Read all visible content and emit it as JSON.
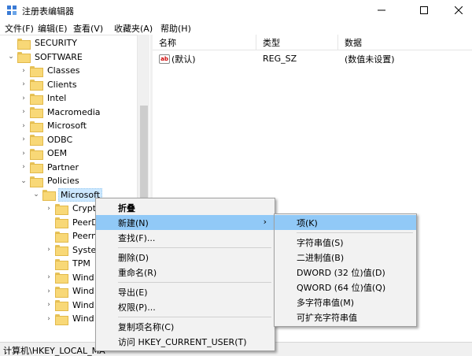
{
  "window": {
    "title": "注册表编辑器",
    "min": "—",
    "max": "☐",
    "close": "✕"
  },
  "menu": [
    "文件(F)",
    "编辑(E)",
    "查看(V)",
    "收藏夹(A)",
    "帮助(H)"
  ],
  "tree": [
    {
      "label": "SECURITY",
      "exp": "",
      "indent": 0
    },
    {
      "label": "SOFTWARE",
      "exp": "⌄",
      "indent": 0
    },
    {
      "label": "Classes",
      "exp": "›",
      "indent": 1
    },
    {
      "label": "Clients",
      "exp": "›",
      "indent": 1
    },
    {
      "label": "Intel",
      "exp": "›",
      "indent": 1
    },
    {
      "label": "Macromedia",
      "exp": "›",
      "indent": 1
    },
    {
      "label": "Microsoft",
      "exp": "›",
      "indent": 1
    },
    {
      "label": "ODBC",
      "exp": "›",
      "indent": 1
    },
    {
      "label": "OEM",
      "exp": "›",
      "indent": 1
    },
    {
      "label": "Partner",
      "exp": "›",
      "indent": 1
    },
    {
      "label": "Policies",
      "exp": "⌄",
      "indent": 1
    },
    {
      "label": "Microsoft",
      "exp": "⌄",
      "indent": 2,
      "selected": true
    },
    {
      "label": "Crypt",
      "exp": "›",
      "indent": 3
    },
    {
      "label": "PeerD",
      "exp": "",
      "indent": 3
    },
    {
      "label": "Peern",
      "exp": "",
      "indent": 3
    },
    {
      "label": "Syste",
      "exp": "›",
      "indent": 3
    },
    {
      "label": "TPM",
      "exp": "",
      "indent": 3
    },
    {
      "label": "Wind",
      "exp": "›",
      "indent": 3
    },
    {
      "label": "Wind",
      "exp": "›",
      "indent": 3
    },
    {
      "label": "Wind",
      "exp": "›",
      "indent": 3
    },
    {
      "label": "Wind",
      "exp": "›",
      "indent": 3
    }
  ],
  "columns": {
    "name": "名称",
    "type": "类型",
    "data": "数据"
  },
  "values": [
    {
      "icon": "ab",
      "name": "(默认)",
      "type": "REG_SZ",
      "data": "(数值未设置)"
    }
  ],
  "context_menu": {
    "collapse": "折叠",
    "new": "新建(N)",
    "new_arrow": "›",
    "find": "查找(F)...",
    "delete": "删除(D)",
    "rename": "重命名(R)",
    "export": "导出(E)",
    "permissions": "权限(P)...",
    "copy_key_name": "复制项名称(C)",
    "goto": "访问 HKEY_CURRENT_USER(T)"
  },
  "submenu": {
    "key": "项(K)",
    "string": "字符串值(S)",
    "binary": "二进制值(B)",
    "dword": "DWORD (32 位)值(D)",
    "qword": "QWORD (64 位)值(Q)",
    "multi": "多字符串值(M)",
    "expand": "可扩充字符串值"
  },
  "status": {
    "path": "计算机\\HKEY_LOCAL_MA"
  },
  "colors": {
    "highlight": "#91c9f7",
    "selection": "#cce8ff",
    "folder": "#f8d877"
  }
}
